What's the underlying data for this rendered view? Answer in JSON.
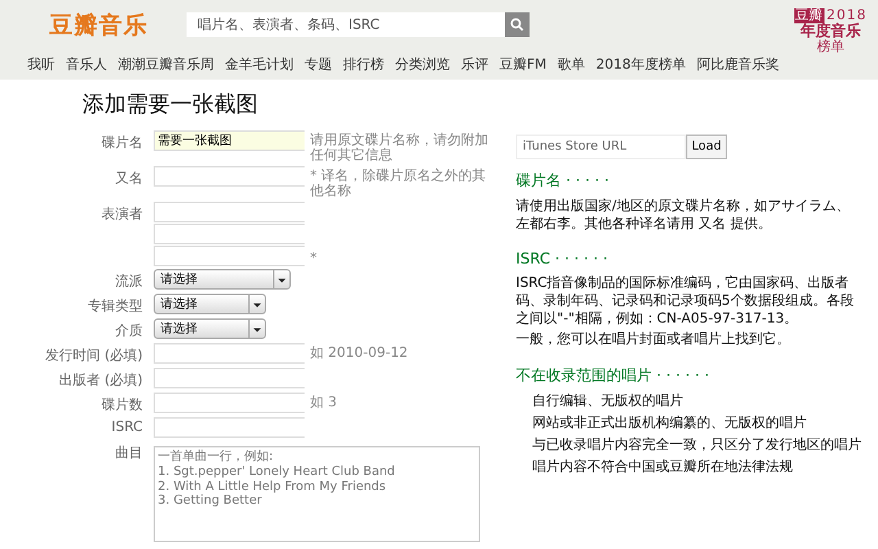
{
  "header": {
    "logo": "豆瓣音乐",
    "search": {
      "placeholder": "唱片名、表演者、条码、ISRC"
    },
    "badge": {
      "tag": "豆瓣",
      "year": "2018",
      "title": "年度音乐",
      "subtitle": "榜单"
    },
    "nav": [
      "我听",
      "音乐人",
      "潮潮豆瓣音乐周",
      "金羊毛计划",
      "专题",
      "排行榜",
      "分类浏览",
      "乐评",
      "豆瓣FM",
      "歌单",
      "2018年度榜单",
      "阿比鹿音乐奖"
    ]
  },
  "page_title": "添加需要一张截图",
  "form": [
    {
      "kind": "text",
      "label": "碟片名",
      "value": "需要一张截图",
      "hint": "请用原文碟片名称，请勿附加任何其它信息",
      "highlighted": true
    },
    {
      "kind": "text",
      "label": "又名",
      "hint": "* 译名，除碟片原名之外的其他名称",
      "highlighted": false
    },
    {
      "kind": "multi",
      "label": "表演者",
      "hint": "*"
    },
    {
      "kind": "select",
      "label": "流派",
      "value": "请选择",
      "wide": true
    },
    {
      "kind": "select",
      "label": "专辑类型",
      "value": "请选择",
      "wide": false
    },
    {
      "kind": "select",
      "label": "介质",
      "value": "请选择",
      "wide": false
    },
    {
      "kind": "text",
      "label": "发行时间 (必填)",
      "hint": "如 2010-09-12",
      "highlighted": false
    },
    {
      "kind": "text",
      "label": "出版者 (必填)",
      "highlighted": false
    },
    {
      "kind": "text",
      "label": "碟片数",
      "hint": "如 3",
      "highlighted": false
    },
    {
      "kind": "text",
      "label": "ISRC",
      "highlighted": false
    },
    {
      "kind": "textarea",
      "label": "曲目",
      "placeholder": "一首单曲一行，例如:\n1. Sgt.pepper' Lonely Heart Club Band\n2. With A Little Help From My Friends\n3. Getting Better"
    }
  ],
  "sidebar": {
    "url_field": {
      "placeholder": "iTunes Store URL"
    },
    "load_button": "Load",
    "sections": [
      {
        "heading": "碟片名 · · · · ·",
        "kind": "text",
        "text": "请使用出版国家/地区的原文碟片名称，如アサイラム、左都右李。其他各种译名请用 又名 提供。"
      },
      {
        "heading": "ISRC · · · · · ·",
        "kind": "paragraphs",
        "paragraphs": [
          "ISRC指音像制品的国际标准编码，它由国家码、出版者码、录制年码、记录码和记录项码5个数据段组成。各段之间以\"-\"相隔，例如：CN-A05-97-317-13。",
          "一般，您可以在唱片封面或者唱片上找到它。"
        ]
      },
      {
        "heading": "不在收录范围的唱片 · · · · · ·",
        "kind": "list",
        "items": [
          "自行编辑、无版权的唱片",
          "网站或非正式出版机构编纂的、无版权的唱片",
          "与已收录唱片内容完全一致，只区分了发行地区的唱片",
          "唱片内容不符合中国或豆瓣所在地法律法规"
        ]
      }
    ]
  }
}
